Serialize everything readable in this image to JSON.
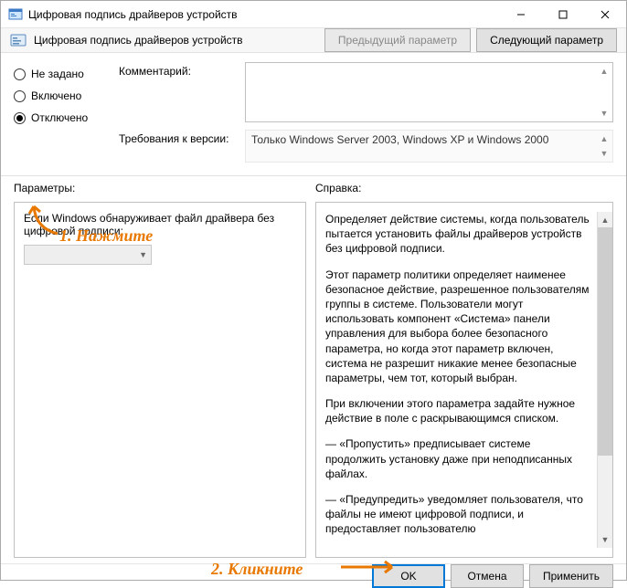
{
  "titlebar": {
    "title": "Цифровая подпись драйверов устройств"
  },
  "ribbon": {
    "title": "Цифровая подпись драйверов устройств",
    "prev": "Предыдущий параметр",
    "next": "Следующий параметр"
  },
  "radios": {
    "not_configured": "Не задано",
    "enabled": "Включено",
    "disabled": "Отключено",
    "selected": "disabled"
  },
  "fields": {
    "comment_label": "Комментарий:",
    "requirements_label": "Требования к версии:",
    "requirements_value": "Только Windows Server 2003, Windows XP и Windows 2000"
  },
  "headers": {
    "params": "Параметры:",
    "help": "Справка:"
  },
  "params_panel": {
    "text": "Если Windows обнаруживает файл драйвера без цифровой подписи:"
  },
  "help_panel": {
    "p1": "Определяет действие системы, когда пользователь пытается установить файлы драйверов устройств без цифровой подписи.",
    "p2": "Этот параметр политики определяет наименее безопасное действие, разрешенное пользователям группы в системе. Пользователи могут использовать компонент «Система» панели управления для выбора более безопасного параметра, но когда этот параметр включен, система не разрешит никакие менее безопасные параметры, чем тот, который выбран.",
    "p3": "При включении этого параметра задайте нужное действие в поле с раскрывающимся списком.",
    "p4": "— «Пропустить» предписывает системе продолжить установку даже при неподписанных файлах.",
    "p5": "— «Предупредить» уведомляет пользователя, что файлы не имеют цифровой подписи, и предоставляет пользователю"
  },
  "footer": {
    "ok": "OK",
    "cancel": "Отмена",
    "apply": "Применить"
  },
  "annotations": {
    "step1": "1. Нажмите",
    "step2": "2. Кликните"
  }
}
